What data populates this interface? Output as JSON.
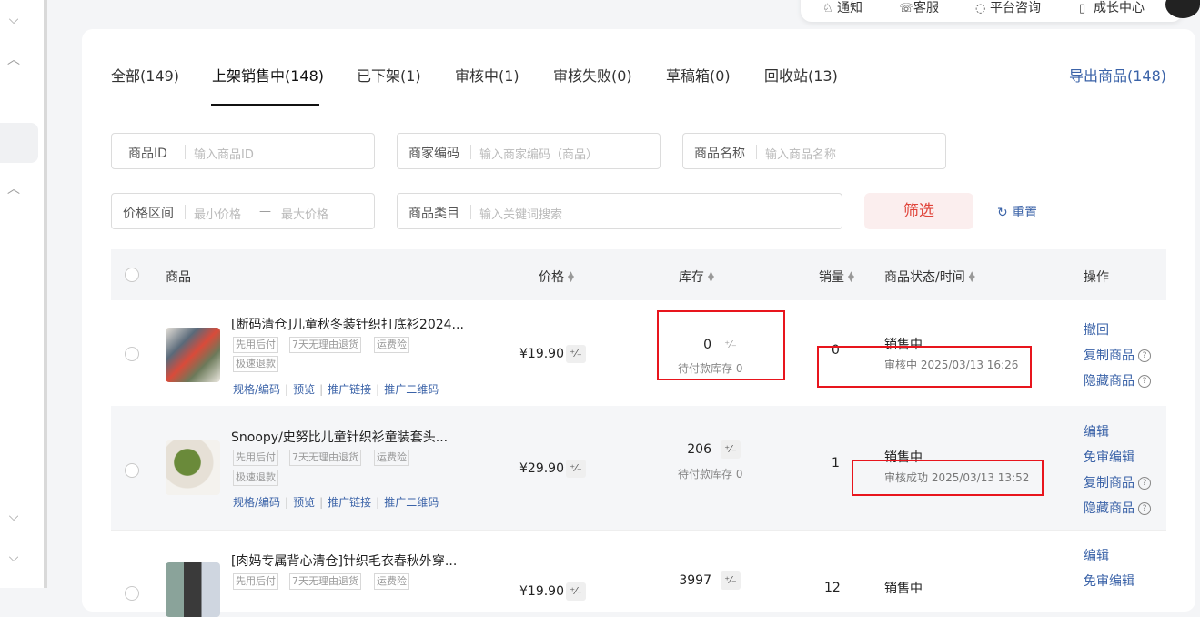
{
  "tabs": [
    {
      "label": "全部(149)"
    },
    {
      "label": "上架销售中(148)"
    },
    {
      "label": "已下架(1)"
    },
    {
      "label": "审核中(1)"
    },
    {
      "label": "审核失败(0)"
    },
    {
      "label": "草稿箱(0)"
    },
    {
      "label": "回收站(13)"
    }
  ],
  "export_label": "导出商品(148)",
  "topbar": {
    "notice": "通知",
    "service": "客服",
    "consult": "平台咨询",
    "growth": "成长中心"
  },
  "filters": {
    "product_id": {
      "label": "商品ID",
      "placeholder": "输入商品ID"
    },
    "merchant_code": {
      "label": "商家编码",
      "placeholder": "输入商家编码（商品）"
    },
    "product_name": {
      "label": "商品名称",
      "placeholder": "输入商品名称"
    },
    "price_range": {
      "label": "价格区间",
      "min_placeholder": "最小价格",
      "dash": "—",
      "max_placeholder": "最大价格"
    },
    "category": {
      "label": "商品类目",
      "placeholder": "输入关键词搜索"
    },
    "filter_button": "筛选",
    "reset_button": "重置"
  },
  "table": {
    "headers": {
      "product": "商品",
      "price": "价格",
      "stock": "库存",
      "sales": "销量",
      "status": "商品状态/时间",
      "ops": "操作"
    },
    "rows": [
      {
        "title": "[断码清仓]儿童秋冬装针织打底衫2024...",
        "tags": [
          "先用后付",
          "7天无理由退货",
          "运费险",
          "极速退款"
        ],
        "links": [
          "规格/编码",
          "预览",
          "推广链接",
          "推广二维码"
        ],
        "price": "¥19.90",
        "stock": "0",
        "pending": "待付款库存 0",
        "sales": "0",
        "status": "销售中",
        "review": "审核中 2025/03/13 16:26",
        "ops": [
          "撤回",
          "复制商品",
          "隐藏商品"
        ]
      },
      {
        "title": "Snoopy/史努比儿童针织衫童装套头...",
        "tags": [
          "先用后付",
          "7天无理由退货",
          "运费险",
          "极速退款"
        ],
        "links": [
          "规格/编码",
          "预览",
          "推广链接",
          "推广二维码"
        ],
        "price": "¥29.90",
        "stock": "206",
        "pending": "待付款库存 0",
        "sales": "1",
        "status": "销售中",
        "review": "审核成功 2025/03/13 13:52",
        "ops": [
          "编辑",
          "免审编辑",
          "复制商品",
          "隐藏商品"
        ]
      },
      {
        "title": "[肉妈专属背心清仓]针织毛衣春秋外穿...",
        "tags": [
          "先用后付",
          "7天无理由退货",
          "运费险"
        ],
        "price": "¥19.90",
        "stock": "3997",
        "sales": "12",
        "status": "销售中",
        "ops": [
          "编辑",
          "免审编辑"
        ]
      }
    ]
  },
  "pct_symbol": "⁺⁄₋",
  "help_symbol": "?",
  "reset_icon": "↻"
}
